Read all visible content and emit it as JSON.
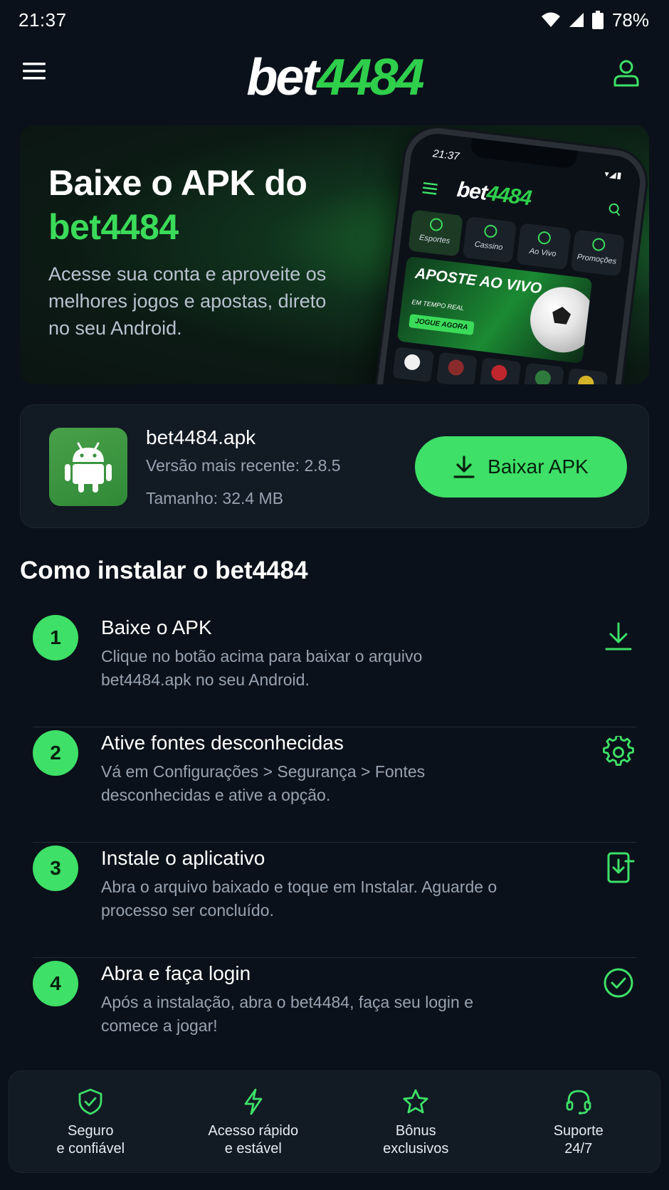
{
  "status_bar": {
    "time": "21:37",
    "battery": "78%"
  },
  "header": {
    "logo_white": "bet",
    "logo_green": "4484"
  },
  "hero": {
    "title_line1": "Baixe o APK do",
    "title_line2": "bet4484",
    "subtitle": "Acesse sua conta e aproveite os melhores jogos e apostas, direto no seu Android.",
    "phone": {
      "time": "21:37",
      "logo_white": "bet",
      "logo_green": "4484",
      "tabs": [
        "Esportes",
        "Cassino",
        "Ao Vivo",
        "Promoções"
      ],
      "banner_title": "APOSTE AO VIVO",
      "banner_sub": "EM TEMPO REAL",
      "banner_cta": "JOGUE AGORA"
    }
  },
  "download": {
    "file_name": "bet4484.apk",
    "version": "Versão mais recente: 2.8.5",
    "size": "Tamanho: 32.4 MB",
    "button_label": "Baixar APK"
  },
  "install": {
    "title": "Como instalar o bet4484",
    "steps": [
      {
        "num": "1",
        "title": "Baixe o APK",
        "desc": "Clique no botão acima para baixar o arquivo bet4484.apk no seu Android.",
        "icon": "download-icon"
      },
      {
        "num": "2",
        "title": "Ative fontes desconhecidas",
        "desc": "Vá em Configurações > Segurança > Fontes desconhecidas e ative a opção.",
        "icon": "gear-icon"
      },
      {
        "num": "3",
        "title": "Instale o aplicativo",
        "desc": "Abra o arquivo baixado e toque em Instalar. Aguarde o processo ser concluído.",
        "icon": "phone-install-icon"
      },
      {
        "num": "4",
        "title": "Abra e faça login",
        "desc": "Após a instalação, abra o bet4484, faça seu login e comece a jogar!",
        "icon": "check-circle-icon"
      }
    ]
  },
  "features": [
    {
      "label": "Seguro\ne confiável",
      "icon": "shield-check-icon"
    },
    {
      "label": "Acesso rápido\ne estável",
      "icon": "lightning-icon"
    },
    {
      "label": "Bônus\nexclusivos",
      "icon": "star-icon"
    },
    {
      "label": "Suporte\n24/7",
      "icon": "headset-icon"
    }
  ],
  "colors": {
    "accent": "#3ee067",
    "background": "#0b111a",
    "card": "#121a24",
    "muted": "#98a3b1"
  }
}
